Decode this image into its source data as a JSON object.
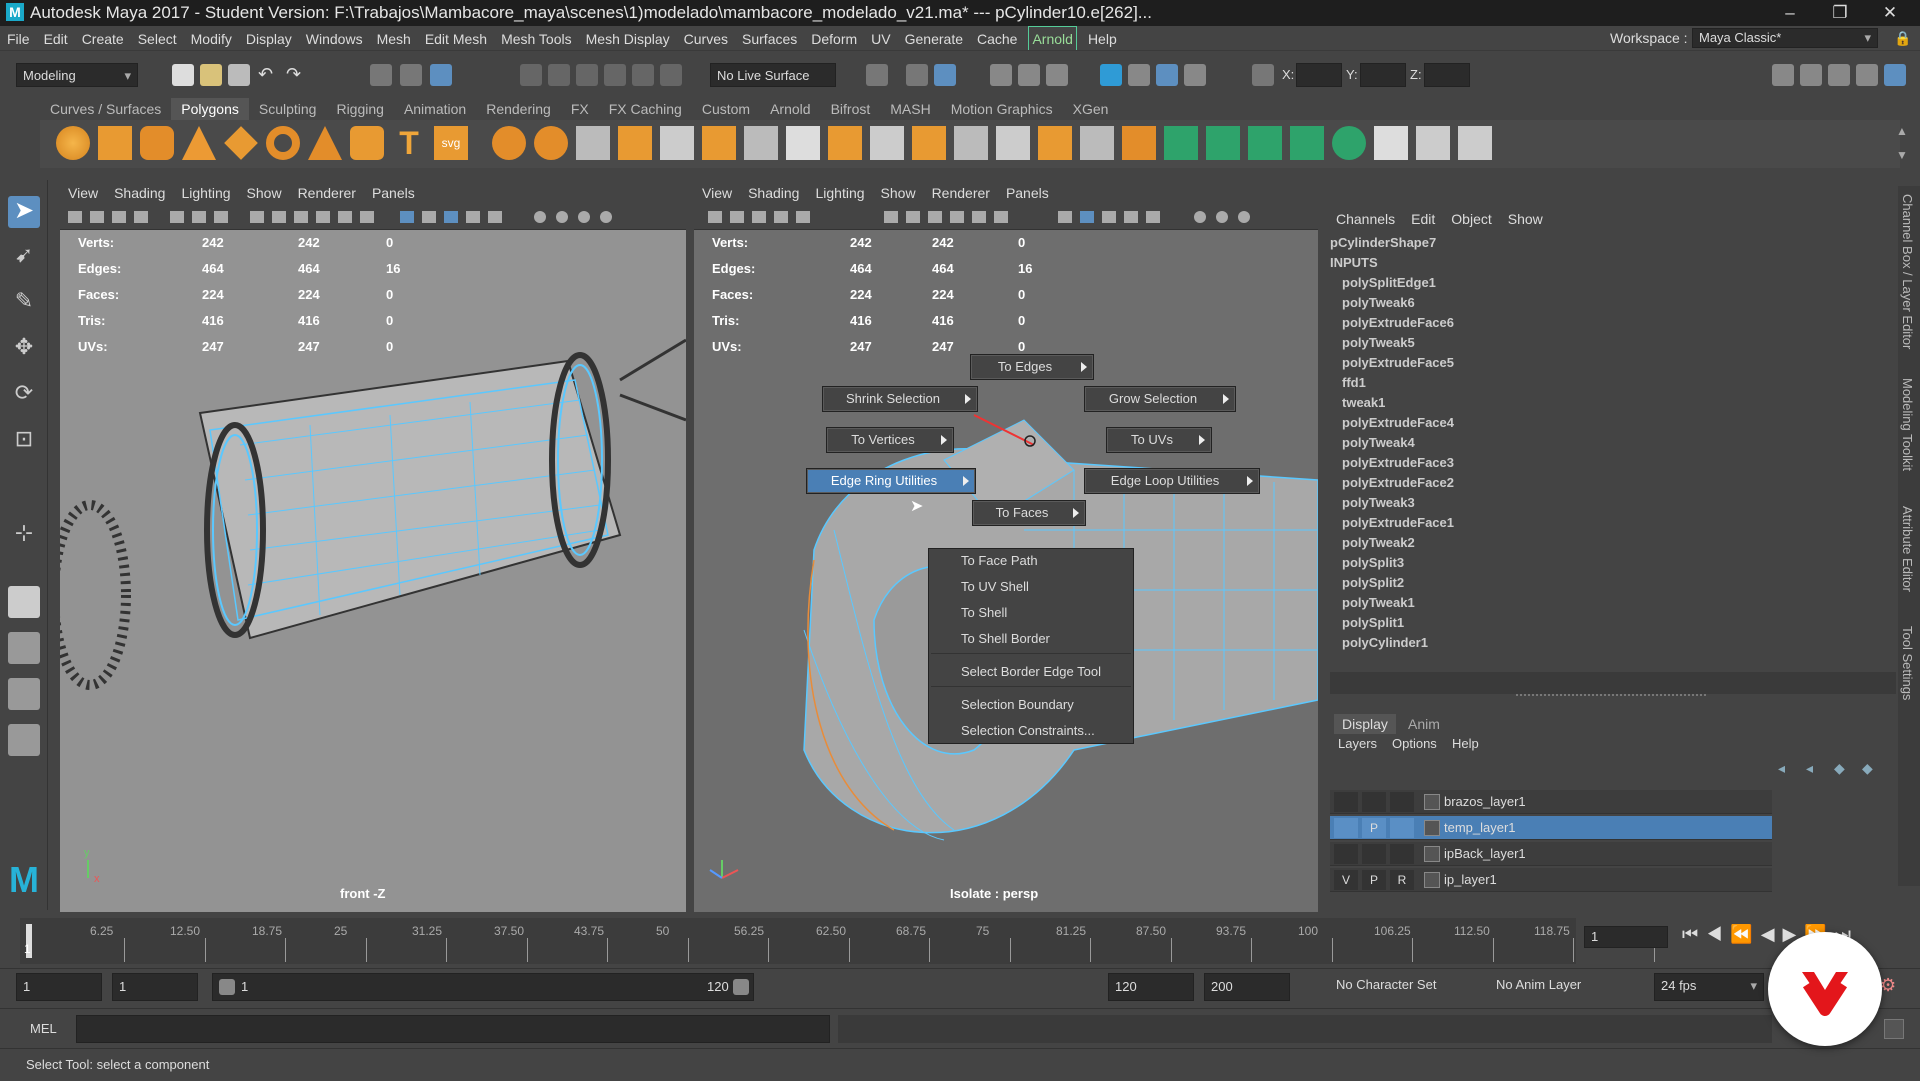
{
  "window": {
    "title": "Autodesk Maya 2017 - Student Version: F:\\Trabajos\\Mambacore_maya\\scenes\\1)modelado\\mambacore_modelado_v21.ma*   ---   pCylinder10.e[262]...",
    "logo": "M"
  },
  "menubar": {
    "items": [
      "File",
      "Edit",
      "Create",
      "Select",
      "Modify",
      "Display",
      "Windows",
      "Mesh",
      "Edit Mesh",
      "Mesh Tools",
      "Mesh Display",
      "Curves",
      "Surfaces",
      "Deform",
      "UV",
      "Generate",
      "Cache"
    ],
    "arnold": "Arnold",
    "help": "Help",
    "workspace_label": "Workspace :",
    "workspace_value": "Maya Classic*"
  },
  "statusline": {
    "mode": "Modeling",
    "live_surface": "No Live Surface",
    "x_label": "X:",
    "y_label": "Y:",
    "z_label": "Z:"
  },
  "shelf": {
    "tabs": [
      "Curves / Surfaces",
      "Polygons",
      "Sculpting",
      "Rigging",
      "Animation",
      "Rendering",
      "FX",
      "FX Caching",
      "Custom",
      "Arnold",
      "Bifrost",
      "MASH",
      "Motion Graphics",
      "XGen"
    ],
    "active_tab": "Polygons"
  },
  "viewport_left": {
    "menu": [
      "View",
      "Shading",
      "Lighting",
      "Show",
      "Renderer",
      "Panels"
    ],
    "hud": [
      {
        "label": "Verts:",
        "a": "242",
        "b": "242",
        "c": "0"
      },
      {
        "label": "Edges:",
        "a": "464",
        "b": "464",
        "c": "16"
      },
      {
        "label": "Faces:",
        "a": "224",
        "b": "224",
        "c": "0"
      },
      {
        "label": "Tris:",
        "a": "416",
        "b": "416",
        "c": "0"
      },
      {
        "label": "UVs:",
        "a": "247",
        "b": "247",
        "c": "0"
      }
    ],
    "camera_label": "front -Z"
  },
  "viewport_right": {
    "menu": [
      "View",
      "Shading",
      "Lighting",
      "Show",
      "Renderer",
      "Panels"
    ],
    "hud": [
      {
        "label": "Verts:",
        "a": "242",
        "b": "242",
        "c": "0"
      },
      {
        "label": "Edges:",
        "a": "464",
        "b": "464",
        "c": "16"
      },
      {
        "label": "Faces:",
        "a": "224",
        "b": "224",
        "c": "0"
      },
      {
        "label": "Tris:",
        "a": "416",
        "b": "416",
        "c": "0"
      },
      {
        "label": "UVs:",
        "a": "247",
        "b": "247",
        "c": "0"
      }
    ],
    "camera_label": "Isolate : persp"
  },
  "marking_menu": {
    "to_edges": "To Edges",
    "shrink": "Shrink Selection",
    "grow": "Grow Selection",
    "to_vertices": "To Vertices",
    "to_uvs": "To UVs",
    "edge_ring": "Edge Ring Utilities",
    "edge_loop": "Edge Loop Utilities",
    "to_faces": "To Faces",
    "submenu": [
      "To Face Path",
      "To UV Shell",
      "To Shell",
      "To Shell Border",
      "Select Border Edge Tool",
      "Selection Boundary",
      "Selection Constraints..."
    ]
  },
  "channelbox": {
    "menu": [
      "Channels",
      "Edit",
      "Object",
      "Show"
    ],
    "shape": "pCylinderShape7",
    "inputs_label": "INPUTS",
    "inputs": [
      "polySplitEdge1",
      "polyTweak6",
      "polyExtrudeFace6",
      "polyTweak5",
      "polyExtrudeFace5",
      "ffd1",
      "tweak1",
      "polyExtrudeFace4",
      "polyTweak4",
      "polyExtrudeFace3",
      "polyExtrudeFace2",
      "polyTweak3",
      "polyExtrudeFace1",
      "polyTweak2",
      "polySplit3",
      "polySplit2",
      "polyTweak1",
      "polySplit1",
      "polyCylinder1"
    ]
  },
  "sidetabs": [
    "Channel Box / Layer Editor",
    "Modeling Toolkit",
    "Attribute Editor",
    "Tool Settings"
  ],
  "layers": {
    "tabs": [
      "Display",
      "Anim"
    ],
    "menu": [
      "Layers",
      "Options",
      "Help"
    ],
    "rows": [
      {
        "name": "brazos_layer1",
        "v": "",
        "p": "",
        "r": ""
      },
      {
        "name": "temp_layer1",
        "v": "",
        "p": "P",
        "r": ""
      },
      {
        "name": "ipBack_layer1",
        "v": "",
        "p": "",
        "r": ""
      },
      {
        "name": "ip_layer1",
        "v": "V",
        "p": "P",
        "r": "R"
      }
    ],
    "selected_index": 1
  },
  "timeline": {
    "labels": [
      "6.25",
      "12.50",
      "18.75",
      "25",
      "31.25",
      "37.50",
      "43.75",
      "50",
      "56.25",
      "62.50",
      "68.75",
      "75",
      "81.25",
      "87.50",
      "93.75",
      "100",
      "106.25",
      "112.50",
      "118.75"
    ],
    "current_frame": "1",
    "current_field": "1"
  },
  "range": {
    "start": "1",
    "anim_start": "1",
    "slider_start": "1",
    "slider_end": "120",
    "end": "120",
    "anim_end": "200",
    "character_set": "No Character Set",
    "anim_layer": "No Anim Layer",
    "fps": "24 fps"
  },
  "cmdline": {
    "label": "MEL"
  },
  "helpline": {
    "text": "Select Tool: select a component"
  },
  "colors": {
    "highlight": "#4a7fb5",
    "wire": "#5ac8ff",
    "arnold": "#5c9"
  }
}
